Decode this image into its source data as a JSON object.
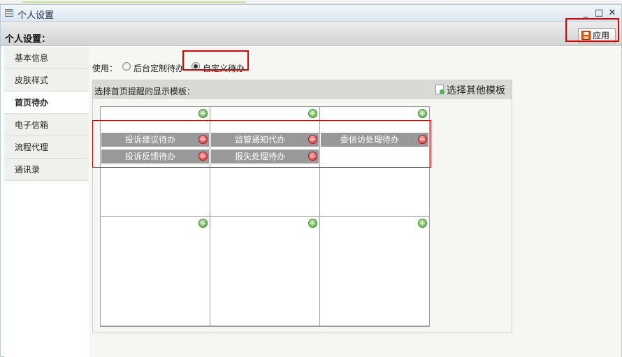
{
  "window": {
    "title": "个人设置",
    "controls": {
      "minimize": "_",
      "maximize": "□",
      "close": "✕"
    }
  },
  "header": {
    "title": "个人设置：",
    "apply_label": "应用"
  },
  "sidebar": {
    "items": [
      {
        "label": "基本信息"
      },
      {
        "label": "皮肤样式"
      },
      {
        "label": "首页待办",
        "active": true
      },
      {
        "label": "电子信箱"
      },
      {
        "label": "流程代理"
      },
      {
        "label": "通讯录"
      }
    ]
  },
  "use": {
    "label": "使用：",
    "options": [
      {
        "label": "后台定制待办",
        "checked": false
      },
      {
        "label": "自定义待办",
        "checked": true
      }
    ]
  },
  "panel": {
    "title": "选择首页提醒的显示模板：",
    "template_link": "选择其他模板"
  },
  "grid": {
    "cells": [
      {
        "items": [
          "投诉建议待办",
          "投诉反馈待办"
        ]
      },
      {
        "items": [
          "监管通知代办",
          "报失处理待办"
        ]
      },
      {
        "items": [
          "委信访处理待办"
        ]
      },
      {
        "items": []
      },
      {
        "items": []
      },
      {
        "items": []
      }
    ]
  },
  "icons": {
    "window": "table-icon",
    "apply": "save-icon",
    "add": "plus-circle-icon",
    "remove": "minus-circle-icon",
    "template": "document-add-icon"
  },
  "colors": {
    "highlight": "#e00000",
    "item_bg": "#999999",
    "add": "#44a532",
    "remove": "#d93030"
  }
}
